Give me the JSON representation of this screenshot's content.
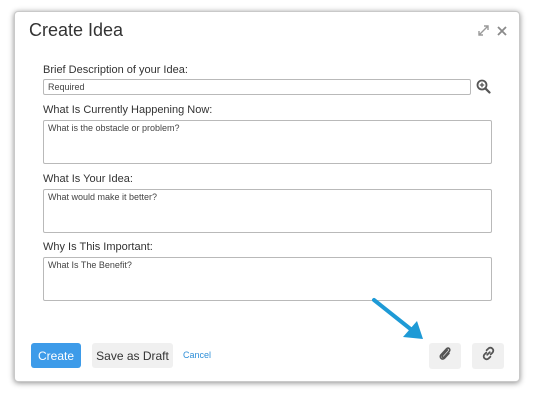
{
  "dialog": {
    "title": "Create Idea",
    "header_icons": [
      "expand-icon",
      "close-icon"
    ]
  },
  "form": {
    "description": {
      "label": "Brief Description of your Idea:",
      "placeholder": "Required",
      "value": ""
    },
    "happening": {
      "label": "What Is Currently Happening Now:",
      "placeholder": "What is the obstacle or problem?",
      "value": ""
    },
    "idea": {
      "label": "What Is Your Idea:",
      "placeholder": "What would make it better?",
      "value": ""
    },
    "importance": {
      "label": "Why Is This Important:",
      "placeholder": "What Is The Benefit?",
      "value": ""
    }
  },
  "footer": {
    "create_label": "Create",
    "draft_label": "Save as Draft",
    "cancel_label": "Cancel",
    "icons": [
      "paperclip-icon",
      "link-icon"
    ]
  },
  "colors": {
    "primary": "#3d9be9",
    "link": "#2f8fd8",
    "annotation_arrow": "#1e9ad6"
  }
}
